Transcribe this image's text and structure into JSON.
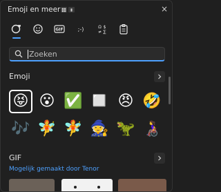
{
  "window": {
    "title": "Emoji en meer",
    "close_glyph": "×"
  },
  "tabs": [
    {
      "name": "tab-recent",
      "icon": "heart-face-icon"
    },
    {
      "name": "tab-emoji",
      "icon": "smiley-icon"
    },
    {
      "name": "tab-gif",
      "icon": "gif-icon",
      "label": "GIF"
    },
    {
      "name": "tab-kaomoji",
      "icon": "kaomoji-icon",
      "label": ";-)"
    },
    {
      "name": "tab-symbols",
      "icon": "symbols-icon"
    },
    {
      "name": "tab-clipboard",
      "icon": "clipboard-icon"
    }
  ],
  "search": {
    "placeholder": "Zoeken"
  },
  "emoji_section": {
    "title": "Emoji",
    "items": [
      "😝",
      "😮",
      "✅",
      "◻️",
      "😠",
      "🤣",
      "🎶",
      "🧚",
      "🧚",
      "🧙",
      "🦖",
      "👩‍🦽"
    ]
  },
  "gif_section": {
    "title": "GIF",
    "subtitle": "Mogelijk gemaakt door Tenor"
  },
  "colors": {
    "accent": "#4ea1ff",
    "background": "#202020"
  }
}
